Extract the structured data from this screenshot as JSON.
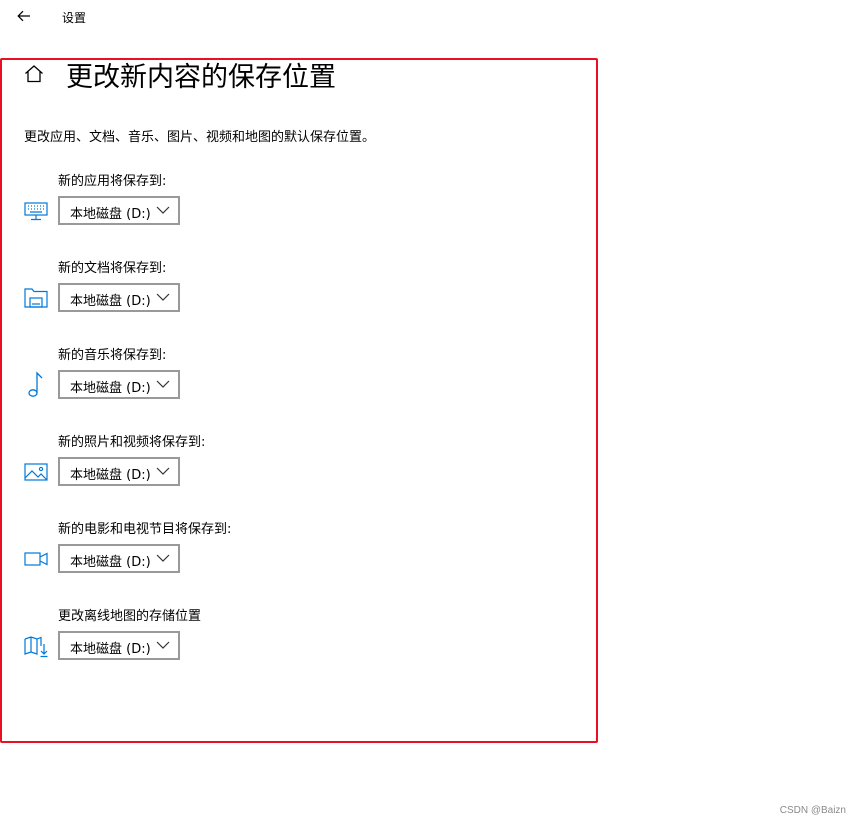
{
  "titlebar": {
    "app_title": "设置"
  },
  "page": {
    "title": "更改新内容的保存位置",
    "description": "更改应用、文档、音乐、图片、视频和地图的默认保存位置。"
  },
  "settings": [
    {
      "label": "新的应用将保存到:",
      "value": "本地磁盘 (D:)",
      "icon": "monitor-icon"
    },
    {
      "label": "新的文档将保存到:",
      "value": "本地磁盘 (D:)",
      "icon": "folder-drive-icon"
    },
    {
      "label": "新的音乐将保存到:",
      "value": "本地磁盘 (D:)",
      "icon": "music-note-icon"
    },
    {
      "label": "新的照片和视频将保存到:",
      "value": "本地磁盘 (D:)",
      "icon": "picture-icon"
    },
    {
      "label": "新的电影和电视节目将保存到:",
      "value": "本地磁盘 (D:)",
      "icon": "video-camera-icon"
    },
    {
      "label": "更改离线地图的存储位置",
      "value": "本地磁盘 (D:)",
      "icon": "map-download-icon"
    }
  ],
  "watermark": "CSDN @Baizn",
  "colors": {
    "accent": "#0078d7",
    "highlight_border": "#e81123",
    "dropdown_border": "#999999"
  }
}
